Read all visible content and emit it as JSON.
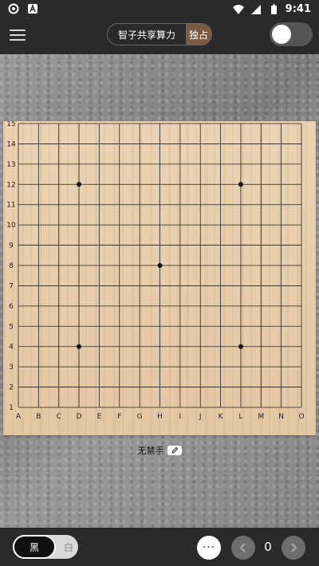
{
  "status_bar": {
    "time": "9:41",
    "left_icons": [
      "gear-icon",
      "app-icon"
    ],
    "right_icons": [
      "wifi-icon",
      "signal-icon",
      "battery-icon"
    ]
  },
  "top_bar": {
    "menu_icon": "hamburger-icon",
    "mode_shared": "智子共享算力",
    "mode_exclusive": "独占",
    "active_mode": "独占",
    "toggle_on": false
  },
  "board": {
    "size": 15,
    "col_labels": [
      "A",
      "B",
      "C",
      "D",
      "E",
      "F",
      "G",
      "H",
      "I",
      "J",
      "K",
      "L",
      "M",
      "N",
      "O"
    ],
    "row_labels": [
      "15",
      "14",
      "13",
      "12",
      "11",
      "10",
      "9",
      "8",
      "7",
      "6",
      "5",
      "4",
      "3",
      "2",
      "1"
    ],
    "star_points": [
      "D12",
      "L12",
      "H8",
      "D4",
      "L4"
    ],
    "board_color": "#e6ccaa"
  },
  "rule": {
    "label": "无禁手",
    "edit_icon": "pencil-icon"
  },
  "bottom_bar": {
    "black_label": "黑",
    "white_label": "白",
    "selected_color": "黑",
    "more_label": "···",
    "move_count": "0",
    "prev_icon": "chevron-left-icon",
    "next_icon": "chevron-right-icon"
  }
}
